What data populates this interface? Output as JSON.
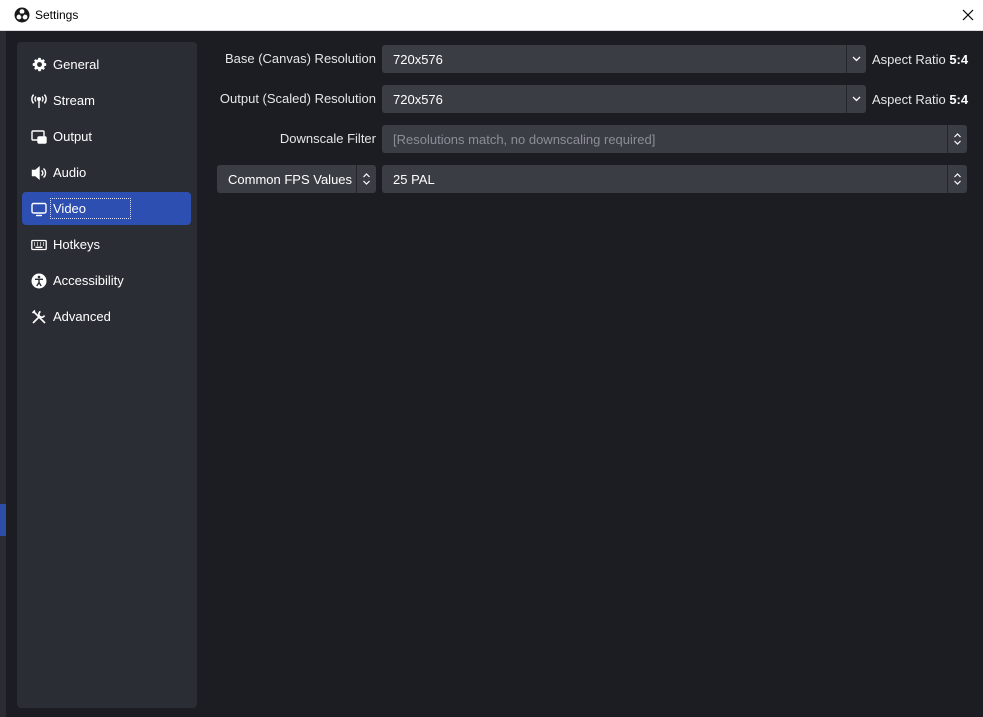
{
  "window": {
    "title": "Settings"
  },
  "colors": {
    "accent": "#2e4fb2",
    "panel": "#2b2d35",
    "field": "#3b3d45",
    "background": "#1c1d23"
  },
  "sidebar": {
    "items": [
      {
        "label": "General",
        "icon": "gear-icon"
      },
      {
        "label": "Stream",
        "icon": "antenna-icon"
      },
      {
        "label": "Output",
        "icon": "output-icon"
      },
      {
        "label": "Audio",
        "icon": "speaker-icon"
      },
      {
        "label": "Video",
        "icon": "monitor-icon",
        "active": true
      },
      {
        "label": "Hotkeys",
        "icon": "keyboard-icon"
      },
      {
        "label": "Accessibility",
        "icon": "accessibility-icon"
      },
      {
        "label": "Advanced",
        "icon": "tools-icon"
      }
    ]
  },
  "video": {
    "base_resolution": {
      "label": "Base (Canvas) Resolution",
      "value": "720x576",
      "aspect_label": "Aspect Ratio",
      "aspect_value": "5:4"
    },
    "output_resolution": {
      "label": "Output (Scaled) Resolution",
      "value": "720x576",
      "aspect_label": "Aspect Ratio",
      "aspect_value": "5:4"
    },
    "downscale_filter": {
      "label": "Downscale Filter",
      "value": "[Resolutions match, no downscaling required]"
    },
    "fps": {
      "type_value": "Common FPS Values",
      "value": "25 PAL"
    }
  }
}
